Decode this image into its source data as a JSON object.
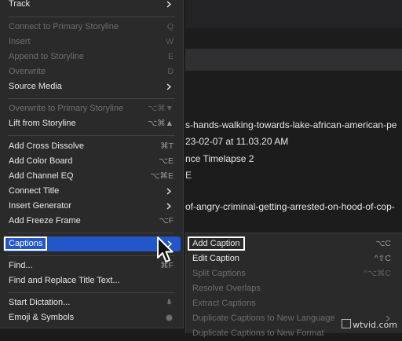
{
  "colors": {
    "menu_bg": "#2a2a2b",
    "highlight": "#2257c9",
    "text": "#e8e8e8",
    "disabled": "#6d6d6f"
  },
  "main_menu": {
    "track": "Track",
    "connect_primary": {
      "label": "Connect to Primary Storyline",
      "shortcut": "Q"
    },
    "insert": {
      "label": "Insert",
      "shortcut": "W"
    },
    "append": {
      "label": "Append to Storyline",
      "shortcut": "E"
    },
    "overwrite": {
      "label": "Overwrite",
      "shortcut": "D"
    },
    "source_media": "Source Media",
    "overwrite_primary": {
      "label": "Overwrite to Primary Storyline",
      "shortcut": "⌥⌘▼"
    },
    "lift": {
      "label": "Lift from Storyline",
      "shortcut": "⌥⌘▲"
    },
    "cross_dissolve": {
      "label": "Add Cross Dissolve",
      "shortcut": "⌘T"
    },
    "color_board": {
      "label": "Add Color Board",
      "shortcut": "⌥E"
    },
    "channel_eq": {
      "label": "Add Channel EQ",
      "shortcut": "⌥⌘E"
    },
    "connect_title": "Connect Title",
    "insert_generator": "Insert Generator",
    "freeze_frame": {
      "label": "Add Freeze Frame",
      "shortcut": "⌥F"
    },
    "captions": "Captions",
    "find": {
      "label": "Find...",
      "shortcut": "⌘F"
    },
    "find_replace": "Find and Replace Title Text...",
    "dictation": "Start Dictation...",
    "emoji": "Emoji & Symbols"
  },
  "captions_submenu": {
    "add_caption": {
      "label": "Add Caption",
      "shortcut": "⌥C"
    },
    "edit_caption": {
      "label": "Edit Caption",
      "shortcut": "^⇧C"
    },
    "split_captions": {
      "label": "Split Captions",
      "shortcut": "^⌥⌘C"
    },
    "resolve_overlaps": "Resolve Overlaps",
    "extract_captions": "Extract Captions",
    "duplicate_language": "Duplicate Captions to New Language",
    "duplicate_format": "Duplicate Captions to New Format"
  },
  "background": {
    "line1": "s-hands-walking-towards-lake-african-american-pe",
    "line2": "23-02-07 at 11.03.20 AM",
    "line3": "nce Timelapse 2",
    "line4": "E",
    "line5": "of-angry-criminal-getting-arrested-on-hood-of-cop-"
  },
  "watermark": "wtvid.com"
}
